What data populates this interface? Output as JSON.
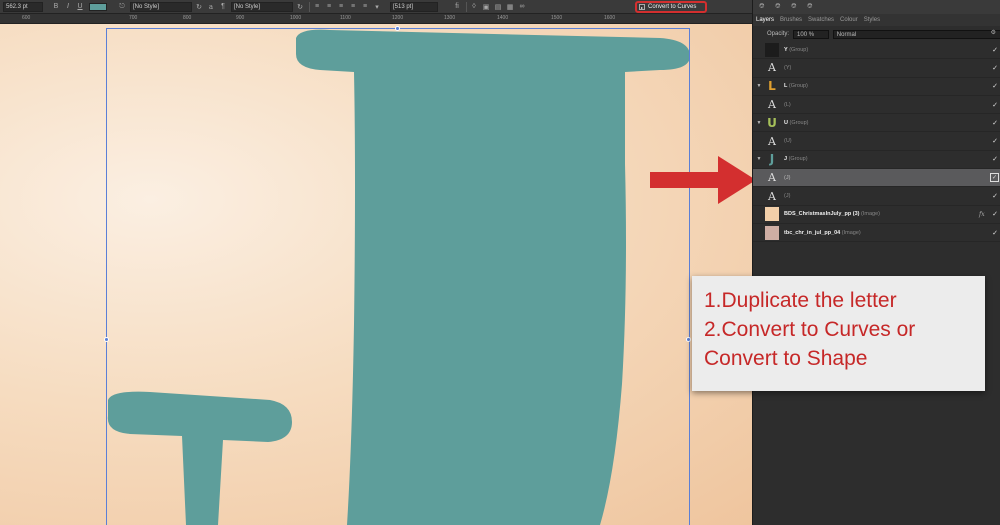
{
  "toolbar": {
    "font_size": "562.3 pt",
    "bold": "B",
    "italic": "I",
    "underline": "U",
    "fill_color": "#5e9e9b",
    "char_style": "[No Style]",
    "para_style": "[No Style]",
    "leading": "[513 pt]",
    "convert_label": "Convert to Curves"
  },
  "ruler": [
    "600",
    "700",
    "800",
    "900",
    "1000",
    "1100",
    "1200",
    "1300",
    "1400",
    "1500",
    "1600"
  ],
  "panel": {
    "tabs": [
      "Layers",
      "Brushes",
      "Swatches",
      "Colour",
      "Styles"
    ],
    "opacity_label": "Opacity:",
    "opacity_value": "100 %",
    "blend_mode": "Normal",
    "layers": [
      {
        "name": "Y",
        "type": "(Group)",
        "thumb": "",
        "thumb_color": "#1c1c1c",
        "expander": "",
        "fx": "",
        "selected": false
      },
      {
        "name": "",
        "type": "(Y)",
        "thumb": "A",
        "thumb_color": "",
        "expander": "",
        "fx": "",
        "selected": false
      },
      {
        "name": "L",
        "type": "(Group)",
        "thumb": "L",
        "thumb_color": "#e0a030",
        "expander": "▼",
        "fx": "",
        "selected": false
      },
      {
        "name": "",
        "type": "(L)",
        "thumb": "A",
        "thumb_color": "",
        "expander": "",
        "fx": "",
        "selected": false
      },
      {
        "name": "U",
        "type": "(Group)",
        "thumb": "U",
        "thumb_color": "#a6c05a",
        "expander": "▼",
        "fx": "",
        "selected": false
      },
      {
        "name": "",
        "type": "(U)",
        "thumb": "A",
        "thumb_color": "",
        "expander": "",
        "fx": "",
        "selected": false
      },
      {
        "name": "J",
        "type": "(Group)",
        "thumb": "J",
        "thumb_color": "#5e9e9b",
        "expander": "▼",
        "fx": "",
        "selected": false
      },
      {
        "name": "",
        "type": "(J)",
        "thumb": "A",
        "thumb_color": "",
        "expander": "",
        "fx": "",
        "selected": true
      },
      {
        "name": "",
        "type": "(J)",
        "thumb": "A",
        "thumb_color": "",
        "expander": "",
        "fx": "",
        "selected": false
      },
      {
        "name": "BDS_ChristmasInJuly_pp (3)",
        "type": "(Image)",
        "thumb": "",
        "thumb_color": "#f2cfa9",
        "expander": "",
        "fx": "fx",
        "selected": false
      },
      {
        "name": "tbc_chr_in_jul_pp_04",
        "type": "(Image)",
        "thumb": "",
        "thumb_color": "#cfaea4",
        "expander": "",
        "fx": "",
        "selected": false
      }
    ]
  },
  "callout": {
    "line1": "1.Duplicate the letter",
    "line2": "2.Convert to Curves or",
    "line3": "Convert to Shape"
  },
  "colors": {
    "letter": "#5e9e9b",
    "annotation": "#d32f2f"
  }
}
